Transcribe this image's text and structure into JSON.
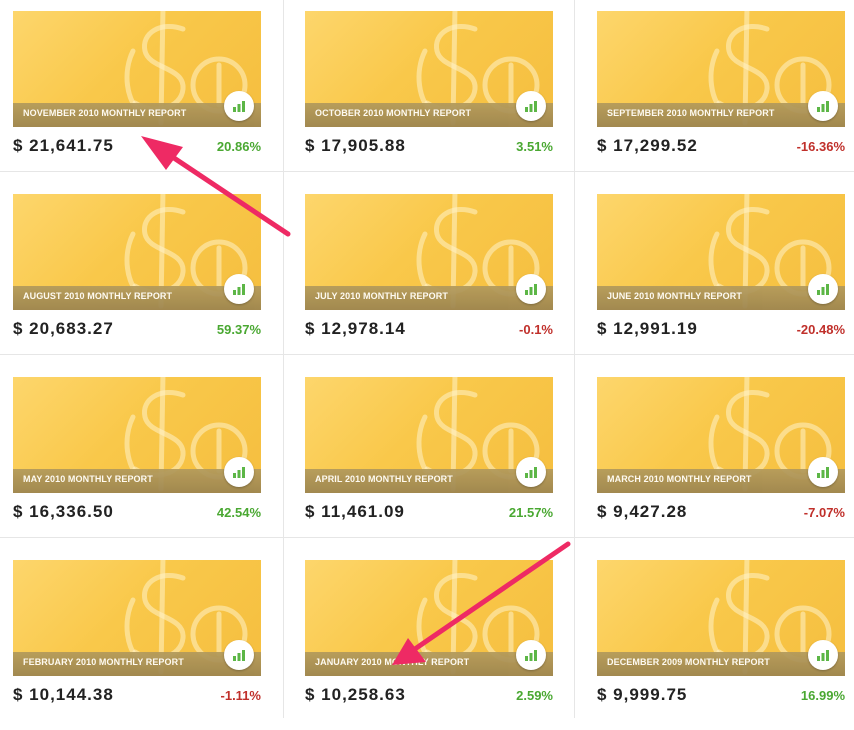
{
  "reports": [
    {
      "title": "NOVEMBER 2010 MONTHLY REPORT",
      "amount": "$ 21,641.75",
      "change": "20.86%",
      "trend": "up"
    },
    {
      "title": "OCTOBER 2010 MONTHLY REPORT",
      "amount": "$ 17,905.88",
      "change": "3.51%",
      "trend": "up"
    },
    {
      "title": "SEPTEMBER 2010 MONTHLY REPORT",
      "amount": "$ 17,299.52",
      "change": "-16.36%",
      "trend": "down"
    },
    {
      "title": "AUGUST 2010 MONTHLY REPORT",
      "amount": "$ 20,683.27",
      "change": "59.37%",
      "trend": "up"
    },
    {
      "title": "JULY 2010 MONTHLY REPORT",
      "amount": "$ 12,978.14",
      "change": "-0.1%",
      "trend": "down"
    },
    {
      "title": "JUNE 2010 MONTHLY REPORT",
      "amount": "$ 12,991.19",
      "change": "-20.48%",
      "trend": "down"
    },
    {
      "title": "MAY 2010 MONTHLY REPORT",
      "amount": "$ 16,336.50",
      "change": "42.54%",
      "trend": "up"
    },
    {
      "title": "APRIL 2010 MONTHLY REPORT",
      "amount": "$ 11,461.09",
      "change": "21.57%",
      "trend": "up"
    },
    {
      "title": "MARCH 2010 MONTHLY REPORT",
      "amount": "$ 9,427.28",
      "change": "-7.07%",
      "trend": "down"
    },
    {
      "title": "FEBRUARY 2010 MONTHLY REPORT",
      "amount": "$ 10,144.38",
      "change": "-1.11%",
      "trend": "down"
    },
    {
      "title": "JANUARY 2010 MONTHLY REPORT",
      "amount": "$ 10,258.63",
      "change": "2.59%",
      "trend": "up"
    },
    {
      "title": "DECEMBER 2009 MONTHLY REPORT",
      "amount": "$ 9,999.75",
      "change": "16.99%",
      "trend": "up"
    }
  ],
  "icons": {
    "thumbnail_decoration": "dollar-cent-sign",
    "chart_button": "bar-chart-icon",
    "annotation": "arrow"
  },
  "colors": {
    "positive": "#4aa832",
    "negative": "#c0302b",
    "thumbnail": "#f9c84a",
    "chart_icon": "#5cb646",
    "annotation_arrow": "#ee2a64"
  }
}
